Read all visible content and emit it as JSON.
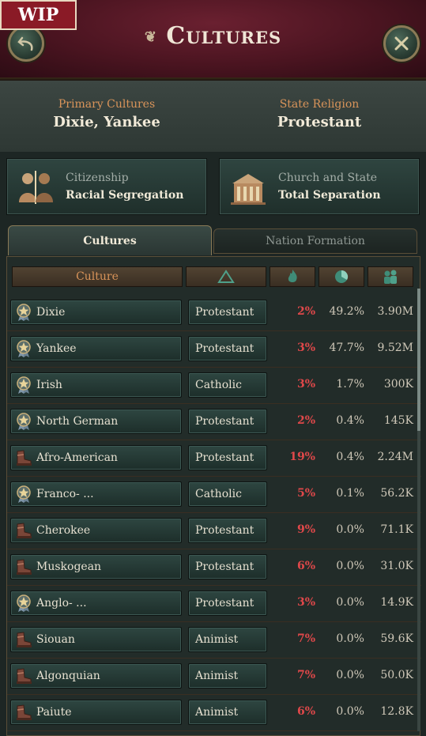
{
  "badge": {
    "wip": "WIP"
  },
  "header": {
    "title": "Cultures",
    "back_icon": "back-arrow-icon",
    "close_icon": "close-icon"
  },
  "summary": {
    "primary_label": "Primary Cultures",
    "primary_value": "Dixie, Yankee",
    "religion_label": "State Religion",
    "religion_value": "Protestant"
  },
  "policies": {
    "citizenship_label": "Citizenship",
    "citizenship_value": "Racial Segregation",
    "church_label": "Church and State",
    "church_value": "Total Separation"
  },
  "tabs": {
    "cultures": "Cultures",
    "nation_formation": "Nation Formation"
  },
  "table": {
    "header_culture": "Culture",
    "header_icons": [
      "religion-triangle-icon",
      "radicalism-flame-icon",
      "share-pie-icon",
      "population-icon"
    ],
    "rows": [
      {
        "icon": "primary-star-icon",
        "culture": "Dixie",
        "religion": "Protestant",
        "radicals": "2%",
        "share": "49.2%",
        "pop": "3.90M"
      },
      {
        "icon": "primary-star-icon",
        "culture": "Yankee",
        "religion": "Protestant",
        "radicals": "3%",
        "share": "47.7%",
        "pop": "9.52M"
      },
      {
        "icon": "primary-star-icon",
        "culture": "Irish",
        "religion": "Catholic",
        "radicals": "3%",
        "share": "1.7%",
        "pop": "300K"
      },
      {
        "icon": "primary-star-icon",
        "culture": "North German",
        "religion": "Protestant",
        "radicals": "2%",
        "share": "0.4%",
        "pop": "145K"
      },
      {
        "icon": "discriminated-boot-icon",
        "culture": "Afro-American",
        "religion": "Protestant",
        "radicals": "19%",
        "share": "0.4%",
        "pop": "2.24M"
      },
      {
        "icon": "primary-star-icon",
        "culture": "Franco- ...",
        "religion": "Catholic",
        "radicals": "5%",
        "share": "0.1%",
        "pop": "56.2K"
      },
      {
        "icon": "discriminated-boot-icon",
        "culture": "Cherokee",
        "religion": "Protestant",
        "radicals": "9%",
        "share": "0.0%",
        "pop": "71.1K"
      },
      {
        "icon": "discriminated-boot-icon",
        "culture": "Muskogean",
        "religion": "Protestant",
        "radicals": "6%",
        "share": "0.0%",
        "pop": "31.0K"
      },
      {
        "icon": "primary-star-icon",
        "culture": "Anglo- ...",
        "religion": "Protestant",
        "radicals": "3%",
        "share": "0.0%",
        "pop": "14.9K"
      },
      {
        "icon": "discriminated-boot-icon",
        "culture": "Siouan",
        "religion": "Animist",
        "radicals": "7%",
        "share": "0.0%",
        "pop": "59.6K"
      },
      {
        "icon": "discriminated-boot-icon",
        "culture": "Algonquian",
        "religion": "Animist",
        "radicals": "7%",
        "share": "0.0%",
        "pop": "50.0K"
      },
      {
        "icon": "discriminated-boot-icon",
        "culture": "Paiute",
        "religion": "Animist",
        "radicals": "6%",
        "share": "0.0%",
        "pop": "12.8K"
      }
    ]
  },
  "colors": {
    "header_bg": "#4a1420",
    "accent_orange": "#d9945a",
    "radical_red": "#e0484a",
    "panel_green": "#2e4641"
  }
}
